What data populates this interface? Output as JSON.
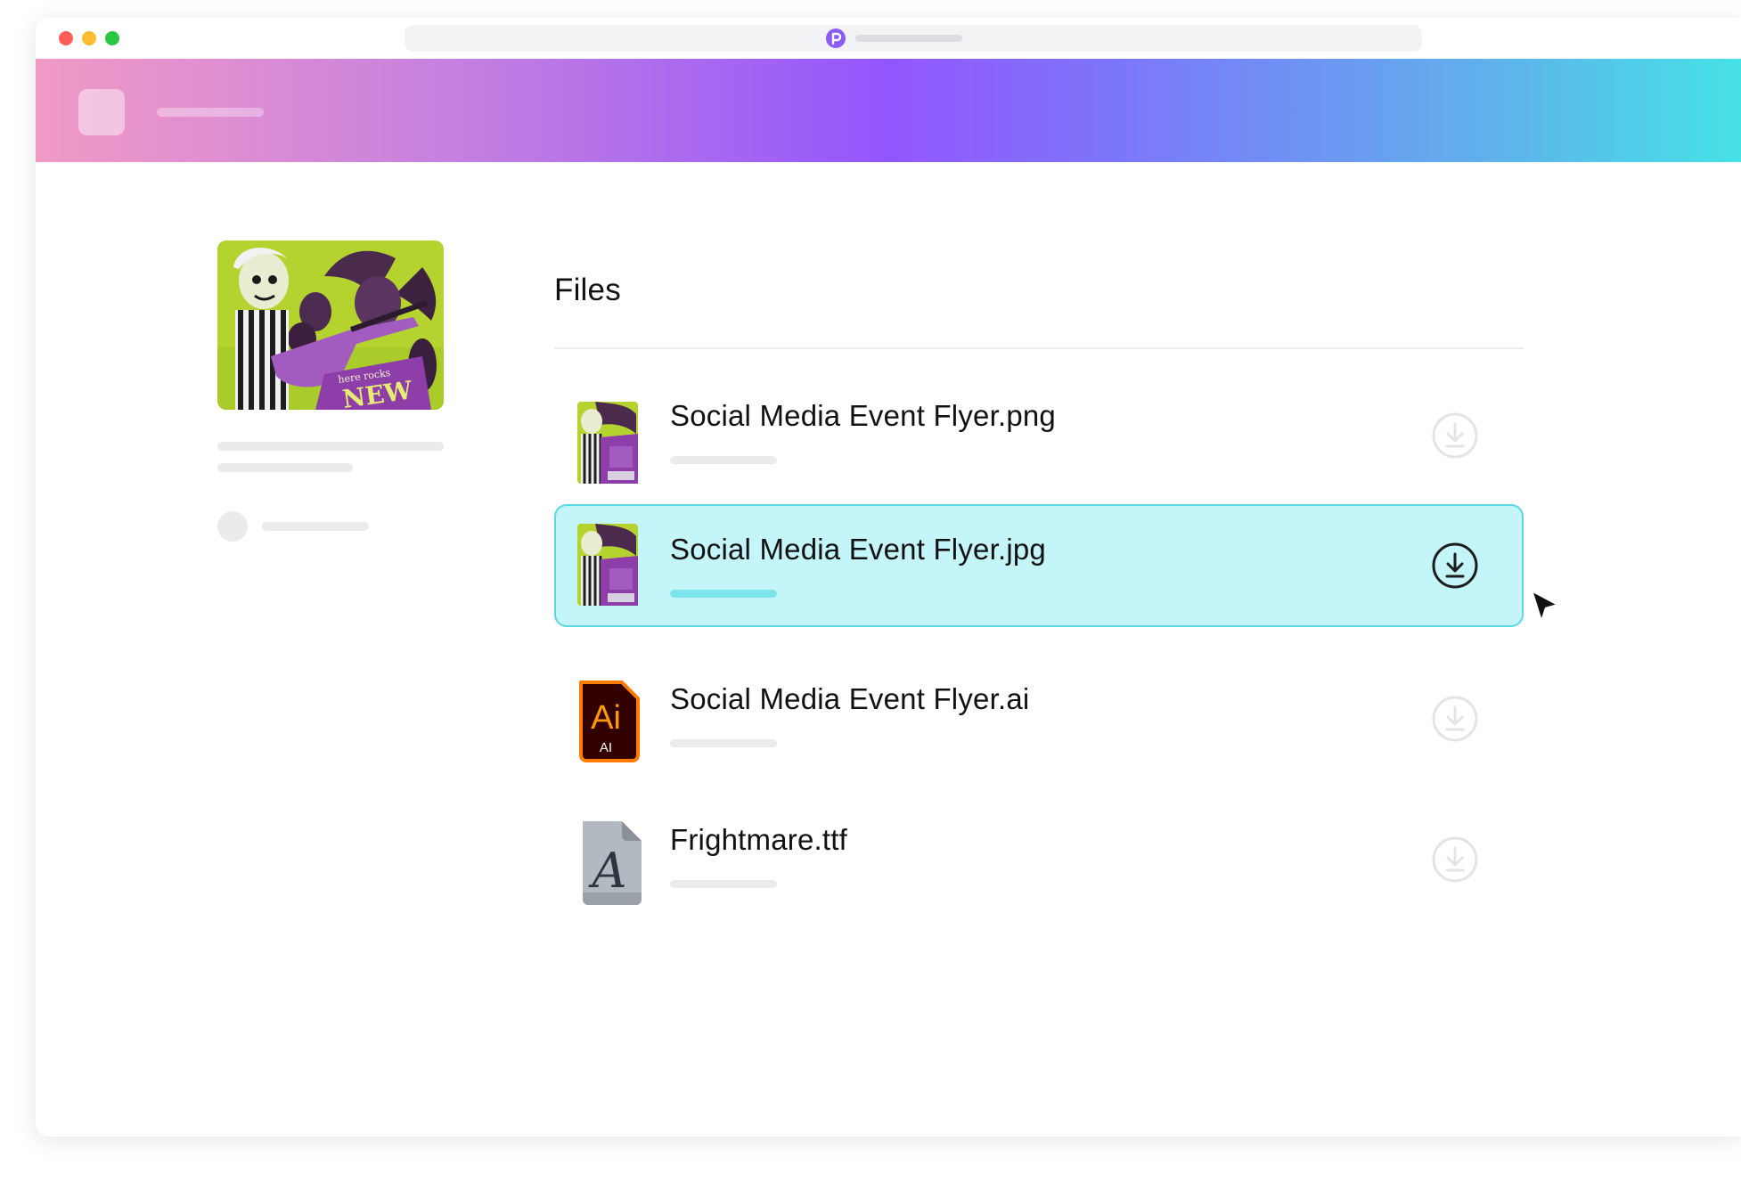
{
  "colors": {
    "dot_red": "#ff5f57",
    "dot_yellow": "#febc2e",
    "dot_green": "#28c840",
    "selected_bg": "#c4f5f8",
    "selected_border": "#5cd8e0",
    "ai_orange": "#ff7c00",
    "ai_dark": "#330000"
  },
  "files": {
    "title": "Files",
    "items": [
      {
        "name": "Social Media Event Flyer.png",
        "icon": "image-thumbnail-icon",
        "selected": false
      },
      {
        "name": "Social Media Event Flyer.jpg",
        "icon": "image-thumbnail-icon",
        "selected": true
      },
      {
        "name": "Social Media Event Flyer.ai",
        "icon": "illustrator-file-icon",
        "selected": false,
        "icon_text": "Ai",
        "icon_subtext": "AI"
      },
      {
        "name": "Frightmare.ttf",
        "icon": "font-file-icon",
        "selected": false,
        "icon_text": "A"
      }
    ]
  },
  "preview": {
    "caption_small": "here rocks",
    "caption_big": "NEW"
  }
}
